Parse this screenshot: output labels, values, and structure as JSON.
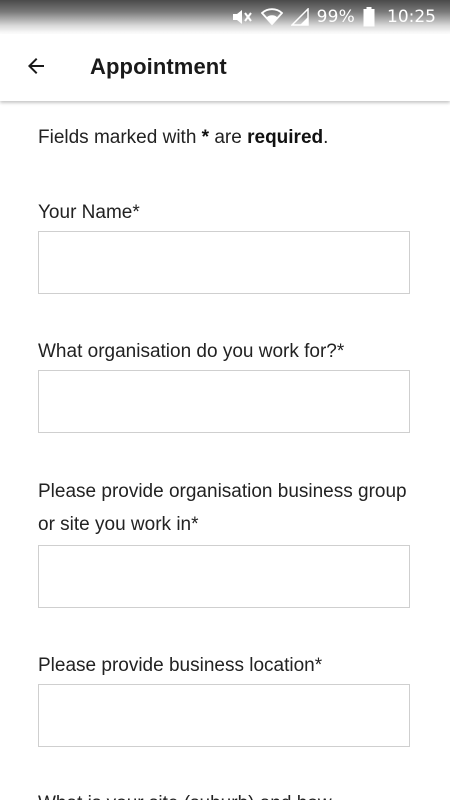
{
  "status_bar": {
    "battery_percent": "99%",
    "time": "10:25",
    "icons": [
      "mute-icon",
      "wifi-icon",
      "signal-icon",
      "battery-icon"
    ]
  },
  "app_bar": {
    "back_icon": "arrow-left-icon",
    "title": "Appointment"
  },
  "form": {
    "intro": {
      "prefix": "Fields marked with ",
      "star": "*",
      "middle": " are ",
      "required_word": "required",
      "suffix": "."
    },
    "fields": [
      {
        "label": "Your Name*",
        "value": "",
        "placeholder": ""
      },
      {
        "label": "What organisation do you work for?*",
        "value": "",
        "placeholder": ""
      },
      {
        "label": "Please provide organisation business group or site you work in*",
        "value": "",
        "placeholder": ""
      },
      {
        "label": "Please provide business location*",
        "value": "",
        "placeholder": ""
      },
      {
        "label": "What is your site (suburb) and how",
        "value": "",
        "placeholder": ""
      }
    ]
  },
  "colors": {
    "status_text": "#ffffff",
    "title_text": "#1a1a1a",
    "input_border": "#cfcfcf"
  }
}
